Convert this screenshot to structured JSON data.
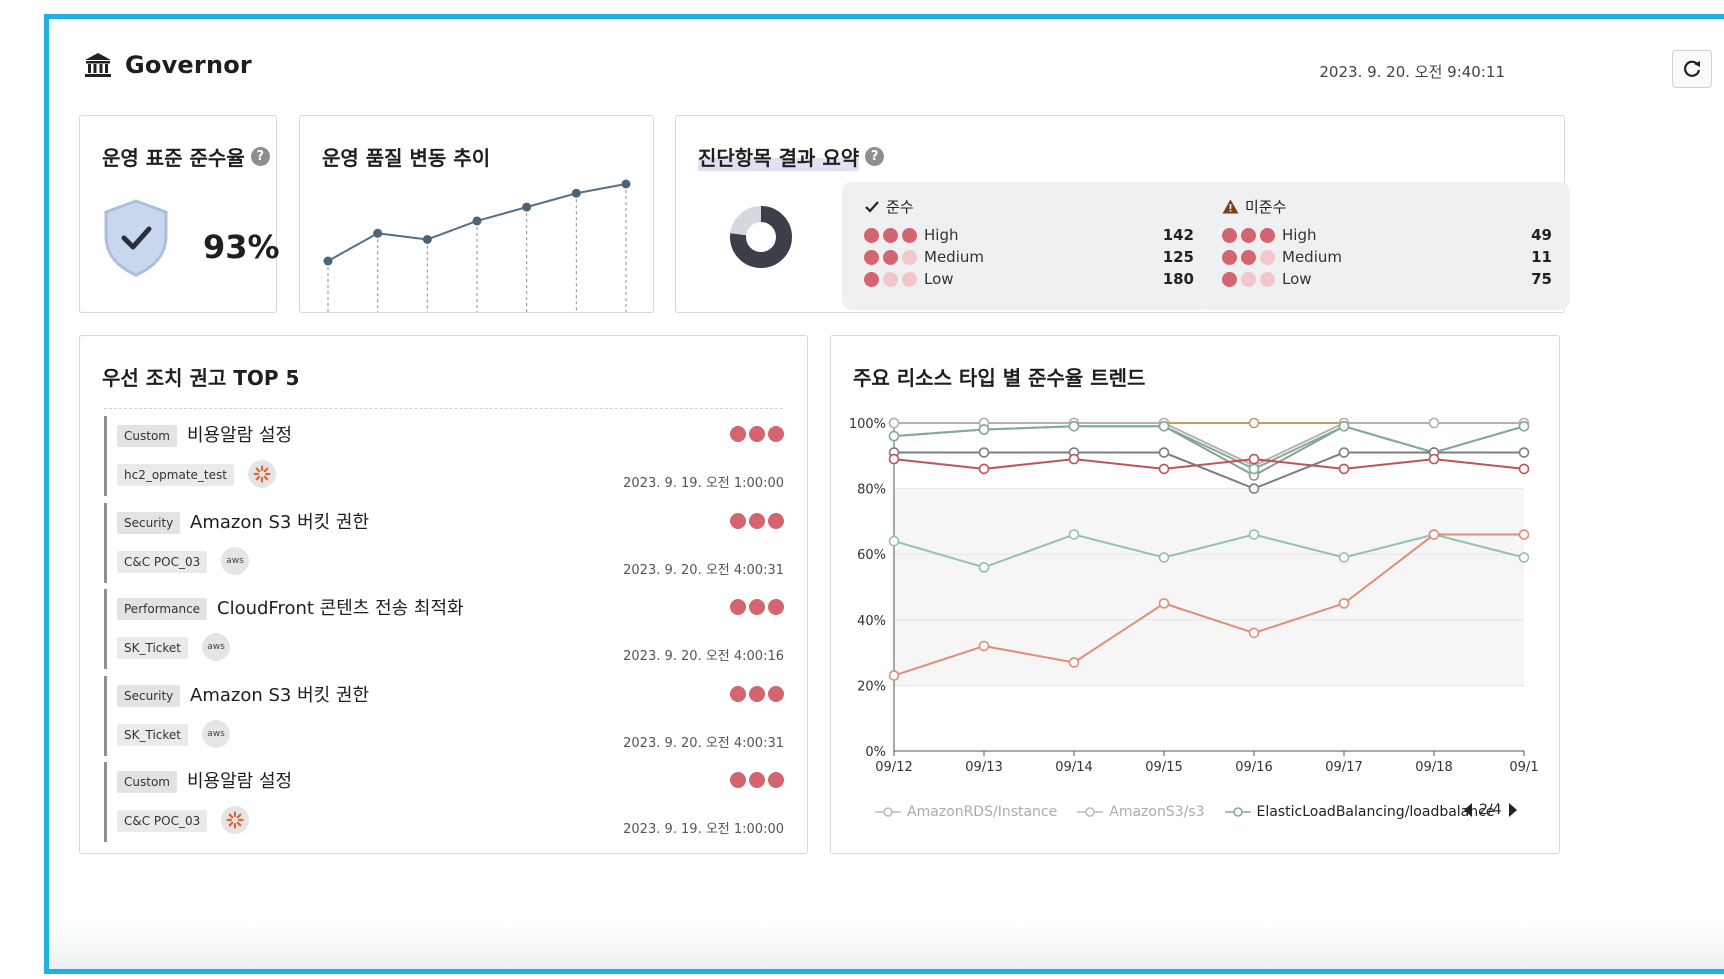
{
  "header": {
    "title": "Governor",
    "timestamp": "2023. 9. 20. 오전 9:40:11"
  },
  "compliance": {
    "title": "운영 표준 준수율",
    "help": "?",
    "value": "93%"
  },
  "quality_trend": {
    "title": "운영 품질 변동 추이",
    "values": [
      1,
      2.8,
      2.4,
      3.6,
      4.5,
      5.4,
      6
    ]
  },
  "summary": {
    "title": "진단항목 결과 요약",
    "help": "?",
    "donut": {
      "compliant": 447,
      "noncompliant": 135,
      "colors": [
        "#3b3f49",
        "#d5d8dc"
      ]
    },
    "compliant": {
      "label": "준수",
      "rows": [
        {
          "level": "High",
          "count": "142",
          "filled": 3
        },
        {
          "level": "Medium",
          "count": "125",
          "filled": 2
        },
        {
          "level": "Low",
          "count": "180",
          "filled": 1
        }
      ]
    },
    "noncompliant": {
      "label": "미준수",
      "rows": [
        {
          "level": "High",
          "count": "49",
          "filled": 3
        },
        {
          "level": "Medium",
          "count": "11",
          "filled": 2
        },
        {
          "level": "Low",
          "count": "75",
          "filled": 1
        }
      ]
    }
  },
  "top5": {
    "title": "우선 조치 권고 TOP 5",
    "items": [
      {
        "tag": "Custom",
        "title": "비용알람 설정",
        "account": "hc2_opmate_test",
        "provider": "custom",
        "time": "2023. 9. 19. 오전 1:00:00"
      },
      {
        "tag": "Security",
        "title": "Amazon S3 버킷 권한",
        "account": "C&C POC_03",
        "provider": "aws",
        "time": "2023. 9. 20. 오전 4:00:31"
      },
      {
        "tag": "Performance",
        "title": "CloudFront 콘텐츠 전송 최적화",
        "account": "SK_Ticket",
        "provider": "aws",
        "time": "2023. 9. 20. 오전 4:00:16"
      },
      {
        "tag": "Security",
        "title": "Amazon S3 버킷 권한",
        "account": "SK_Ticket",
        "provider": "aws",
        "time": "2023. 9. 20. 오전 4:00:31"
      },
      {
        "tag": "Custom",
        "title": "비용알람 설정",
        "account": "C&C POC_03",
        "provider": "custom",
        "time": "2023. 9. 19. 오전 1:00:00"
      }
    ],
    "provider_labels": {
      "aws": "aws",
      "custom": ""
    }
  },
  "trend": {
    "title": "주요 리소스 타입 별 준수율 트렌드",
    "legend": [
      "AmazonRDS/Instance",
      "AmazonS3/s3",
      "ElasticLoadBalancing/loadbalance"
    ],
    "pager": "2/4"
  },
  "chart_data": {
    "type": "line",
    "x": [
      "09/12",
      "09/13",
      "09/14",
      "09/15",
      "09/16",
      "09/17",
      "09/18",
      "09/1"
    ],
    "yticks": [
      "0%",
      "20%",
      "40%",
      "60%",
      "80%",
      "100%"
    ],
    "ylim": [
      0,
      100
    ],
    "series": [
      {
        "color": "#c89a63",
        "values": [
          100,
          100,
          100,
          100,
          100,
          100,
          100,
          100
        ]
      },
      {
        "color": "#b8b0ae",
        "values": [
          100,
          100,
          100,
          100,
          87,
          100,
          100,
          100
        ]
      },
      {
        "color": "#8f9a93",
        "values": [
          96,
          98,
          99,
          99,
          84,
          99,
          91,
          99
        ]
      },
      {
        "color": "#7fae96",
        "values": [
          96,
          98,
          99,
          99,
          86,
          99,
          91,
          99
        ]
      },
      {
        "color": "#7b7e84",
        "values": [
          91,
          91,
          91,
          91,
          80,
          91,
          91,
          91
        ]
      },
      {
        "color": "#c0525c",
        "values": [
          89,
          86,
          89,
          86,
          89,
          86,
          89,
          86
        ]
      },
      {
        "color": "#93c2ad",
        "values": [
          64,
          56,
          66,
          59,
          66,
          59,
          66,
          59
        ]
      },
      {
        "color": "#e08e76",
        "values": [
          23,
          32,
          27,
          45,
          36,
          45,
          66,
          66
        ]
      }
    ]
  }
}
